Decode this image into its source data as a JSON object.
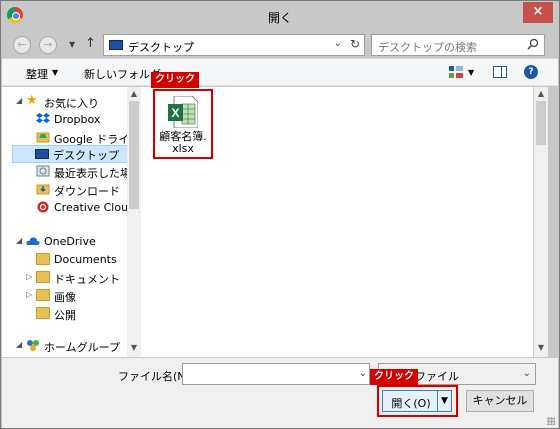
{
  "window": {
    "title": "開く",
    "close_label": "×"
  },
  "address_bar": {
    "back_label": "←",
    "forward_label": "→",
    "up_label": "↑",
    "path": "デスクトップ",
    "path_chevron": "›",
    "refresh_label": "↻",
    "search_placeholder": "デスクトップの検索"
  },
  "toolbar": {
    "organize_label": "整理",
    "new_folder_label": "新しいフォルダー",
    "help_label": "?"
  },
  "nav_pane": {
    "favorites": {
      "label": "お気に入り",
      "items": [
        {
          "label": "Dropbox",
          "icon": "dropbox-icon"
        },
        {
          "label": "Google ドライブ",
          "icon": "google-drive-icon"
        },
        {
          "label": "デスクトップ",
          "icon": "desktop-icon",
          "selected": true
        },
        {
          "label": "最近表示した場所",
          "icon": "recent-places-icon"
        },
        {
          "label": "ダウンロード",
          "icon": "downloads-icon"
        },
        {
          "label": "Creative Cloud",
          "icon": "creative-cloud-icon"
        }
      ]
    },
    "onedrive": {
      "label": "OneDrive",
      "items": [
        {
          "label": "Documents",
          "icon": "folder-icon"
        },
        {
          "label": "ドキュメント",
          "icon": "folder-icon"
        },
        {
          "label": "画像",
          "icon": "folder-icon"
        },
        {
          "label": "公開",
          "icon": "folder-icon"
        }
      ]
    },
    "homegroup": {
      "label": "ホームグループ"
    }
  },
  "content": {
    "files": [
      {
        "name_line1": "顧客名簿.",
        "name_line2": "xlsx",
        "icon": "excel-file-icon"
      }
    ]
  },
  "annotations": {
    "click_file": "クリック",
    "click_open": "クリック",
    "color": "#d40000"
  },
  "bottom": {
    "filename_label": "ファイル名(N):",
    "filename_value": "",
    "filetype_value": "ファイル",
    "open_label": "開く(O)",
    "cancel_label": "キャンセル"
  },
  "colors": {
    "title_bar": "#c8c8c8",
    "close_button": "#c7504a",
    "selected_nav": "#cce8ff",
    "excel_green": "#217346"
  }
}
